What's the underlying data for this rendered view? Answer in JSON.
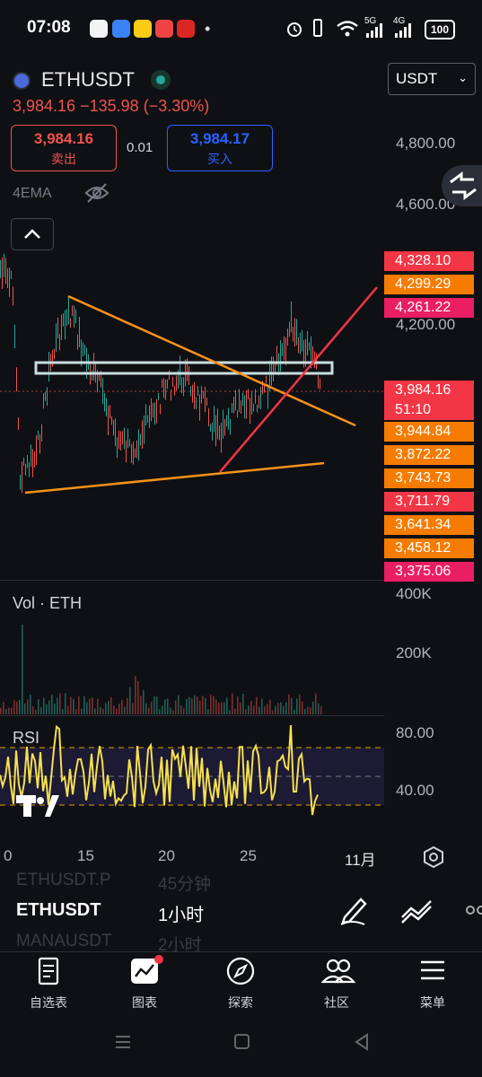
{
  "status_bar": {
    "time": "07:08",
    "dot": "•",
    "network_1": "5G",
    "network_2": "4G",
    "battery": "100"
  },
  "header": {
    "symbol": "ETHUSDT",
    "price": "3,984.16",
    "change": "−135.98",
    "change_pct": "(−3.30%)",
    "currency": "USDT",
    "sell_price": "3,984.16",
    "sell_label": "卖出",
    "spread": "0.01",
    "buy_price": "3,984.17",
    "buy_label": "买入",
    "indicator": "4EMA"
  },
  "price_axis": {
    "labels": [
      "4,800.00",
      "4,600.00",
      "4,200.00"
    ],
    "tags": [
      {
        "text": "4,328.10",
        "color": "#f23645"
      },
      {
        "text": "4,299.29",
        "color": "#f57c00"
      },
      {
        "text": "4,261.22",
        "color": "#e91e63"
      },
      {
        "text": "3,984.16",
        "color": "#f23645"
      },
      {
        "text": "51:10",
        "color": "#f23645"
      },
      {
        "text": "3,944.84",
        "color": "#f57c00"
      },
      {
        "text": "3,872.22",
        "color": "#f57c00"
      },
      {
        "text": "3,743.73",
        "color": "#f57c00"
      },
      {
        "text": "3,711.79",
        "color": "#f23645"
      },
      {
        "text": "3,641.34",
        "color": "#f57c00"
      },
      {
        "text": "3,458.12",
        "color": "#f57c00"
      },
      {
        "text": "3,375.06",
        "color": "#e91e63"
      }
    ]
  },
  "volume": {
    "title": "Vol · ETH",
    "labels": [
      "400K",
      "200K"
    ]
  },
  "rsi": {
    "title": "RSI",
    "labels": [
      "80.00",
      "40.00"
    ]
  },
  "time_axis": {
    "labels": [
      "0",
      "15",
      "20",
      "25",
      "11月"
    ]
  },
  "symbol_list": {
    "prev_symbol": "ETHUSDT.P",
    "prev_tf": "45分钟",
    "current_symbol": "ETHUSDT",
    "current_tf": "1小时",
    "next_symbol": "MANAUSDT",
    "next_tf": "2小时"
  },
  "bottom_nav": [
    {
      "label": "自选表",
      "icon": "watchlist-icon"
    },
    {
      "label": "图表",
      "icon": "chart-icon"
    },
    {
      "label": "探索",
      "icon": "compass-icon"
    },
    {
      "label": "社区",
      "icon": "community-icon"
    },
    {
      "label": "菜单",
      "icon": "menu-icon"
    }
  ]
}
